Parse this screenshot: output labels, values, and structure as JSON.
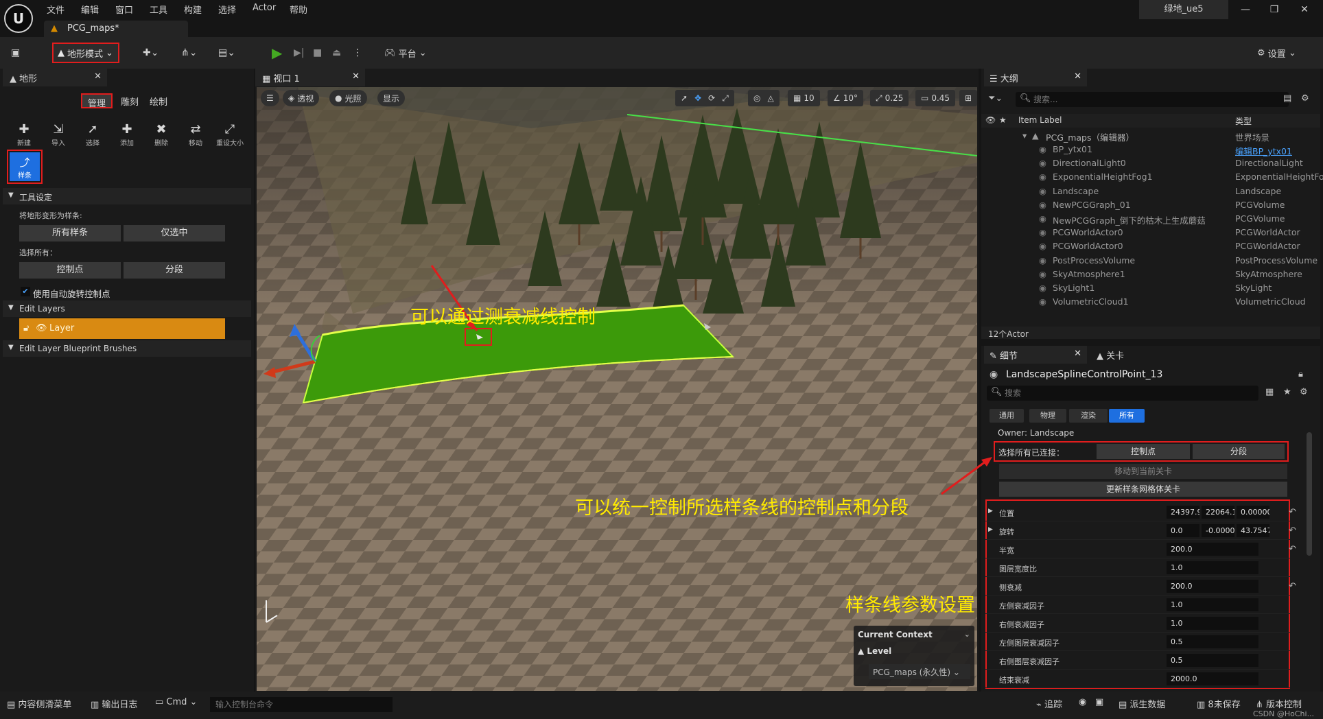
{
  "app": {
    "menus": [
      "文件",
      "编辑",
      "窗口",
      "工具",
      "构建",
      "选择",
      "Actor",
      "帮助"
    ],
    "doc_tab": "PCG_maps*",
    "project": "绿地_ue5"
  },
  "toolbar": {
    "mode": "地形模式",
    "platform": "平台",
    "settings": "设置"
  },
  "landscape_panel": {
    "title": "地形",
    "tabs": [
      "管理",
      "雕刻",
      "绘制"
    ],
    "tools": [
      "新建",
      "导入",
      "选择",
      "添加",
      "删除",
      "移动",
      "重设大小"
    ],
    "spline_tool": "样条",
    "tool_settings": {
      "header": "工具设定",
      "deform_label": "将地形变形为样条:",
      "all_splines": "所有样条",
      "only_selected": "仅选中",
      "select_all_label": "选择所有：",
      "control_points": "控制点",
      "segments": "分段",
      "auto_rotate": "使用自动旋转控制点"
    },
    "edit_layers": {
      "header": "Edit Layers",
      "layer": "Layer"
    },
    "blueprint_brushes": "Edit Layer Blueprint Brushes"
  },
  "viewport": {
    "tab": "视口 1",
    "perspective": "透视",
    "lit": "光照",
    "show": "显示",
    "grid": "10",
    "angle": "10°",
    "scale": "0.25",
    "camera": "0.45",
    "context": {
      "title": "Current Context",
      "level": "Level",
      "map": "PCG_maps (永久性)"
    }
  },
  "annotations": {
    "falloff": "可以通过测衰减线控制",
    "unified": "可以统一控制所选样条线的控制点和分段",
    "params": "样条线参数设置"
  },
  "outliner": {
    "title": "大纲",
    "search_placeholder": "搜索...",
    "col_label": "Item Label",
    "col_type": "类型",
    "root": {
      "name": "PCG_maps（编辑器）",
      "type": "世界场景"
    },
    "items": [
      {
        "name": "BP_ytx01",
        "type": "编辑BP_ytx01"
      },
      {
        "name": "DirectionalLight0",
        "type": "DirectionalLight"
      },
      {
        "name": "ExponentialHeightFog1",
        "type": "ExponentialHeightFo"
      },
      {
        "name": "Landscape",
        "type": "Landscape"
      },
      {
        "name": "NewPCGGraph_01",
        "type": "PCGVolume"
      },
      {
        "name": "NewPCGGraph_倒下的枯木上生成蘑菇",
        "type": "PCGVolume"
      },
      {
        "name": "PCGWorldActor0",
        "type": "PCGWorldActor"
      },
      {
        "name": "PCGWorldActor0",
        "type": "PCGWorldActor"
      },
      {
        "name": "PostProcessVolume",
        "type": "PostProcessVolume"
      },
      {
        "name": "SkyAtmosphere1",
        "type": "SkyAtmosphere"
      },
      {
        "name": "SkyLight1",
        "type": "SkyLight"
      },
      {
        "name": "VolumetricCloud1",
        "type": "VolumetricCloud"
      }
    ],
    "count": "12个Actor"
  },
  "details": {
    "tab": "细节",
    "tab2": "关卡",
    "object": "LandscapeSplineControlPoint_13",
    "search_placeholder": "搜索",
    "filters": [
      "通用",
      "物理",
      "渲染",
      "所有"
    ],
    "owner": "Owner: Landscape",
    "select_connected": "选择所有已连接：",
    "control_points": "控制点",
    "segments": "分段",
    "move_to_level": "移动到当前关卡",
    "update_mesh": "更新样条网格体关卡",
    "props": [
      {
        "label": "位置",
        "v": [
          "24397.9",
          "22064.1",
          "0.00000"
        ]
      },
      {
        "label": "旋转",
        "v": [
          "0.0",
          "-0.00000",
          "43.7547"
        ]
      },
      {
        "label": "半宽",
        "v": [
          "200.0"
        ]
      },
      {
        "label": "图层宽度比",
        "v": [
          "1.0"
        ]
      },
      {
        "label": "侧衰减",
        "v": [
          "200.0"
        ]
      },
      {
        "label": "左侧衰减因子",
        "v": [
          "1.0"
        ]
      },
      {
        "label": "右侧衰减因子",
        "v": [
          "1.0"
        ]
      },
      {
        "label": "左侧图层衰减因子",
        "v": [
          "0.5"
        ]
      },
      {
        "label": "右侧图层衰减因子",
        "v": [
          "0.5"
        ]
      },
      {
        "label": "结束衰减",
        "v": [
          "2000.0"
        ]
      }
    ]
  },
  "statusbar": {
    "content_drawer": "内容侧滑菜单",
    "output_log": "输出日志",
    "cmd": "Cmd",
    "cmd_placeholder": "输入控制台命令",
    "trace": "追踪",
    "derived": "派生数据",
    "unsaved": "8未保存",
    "source_control": "版本控制",
    "watermark": "CSDN @HoChi..."
  },
  "colors": {
    "accent": "#1e6fe0",
    "landscape_green": "#3c9a0a",
    "layer": "#d98a12",
    "annotation": "#ffea00",
    "redbox": "#e11d1d"
  }
}
